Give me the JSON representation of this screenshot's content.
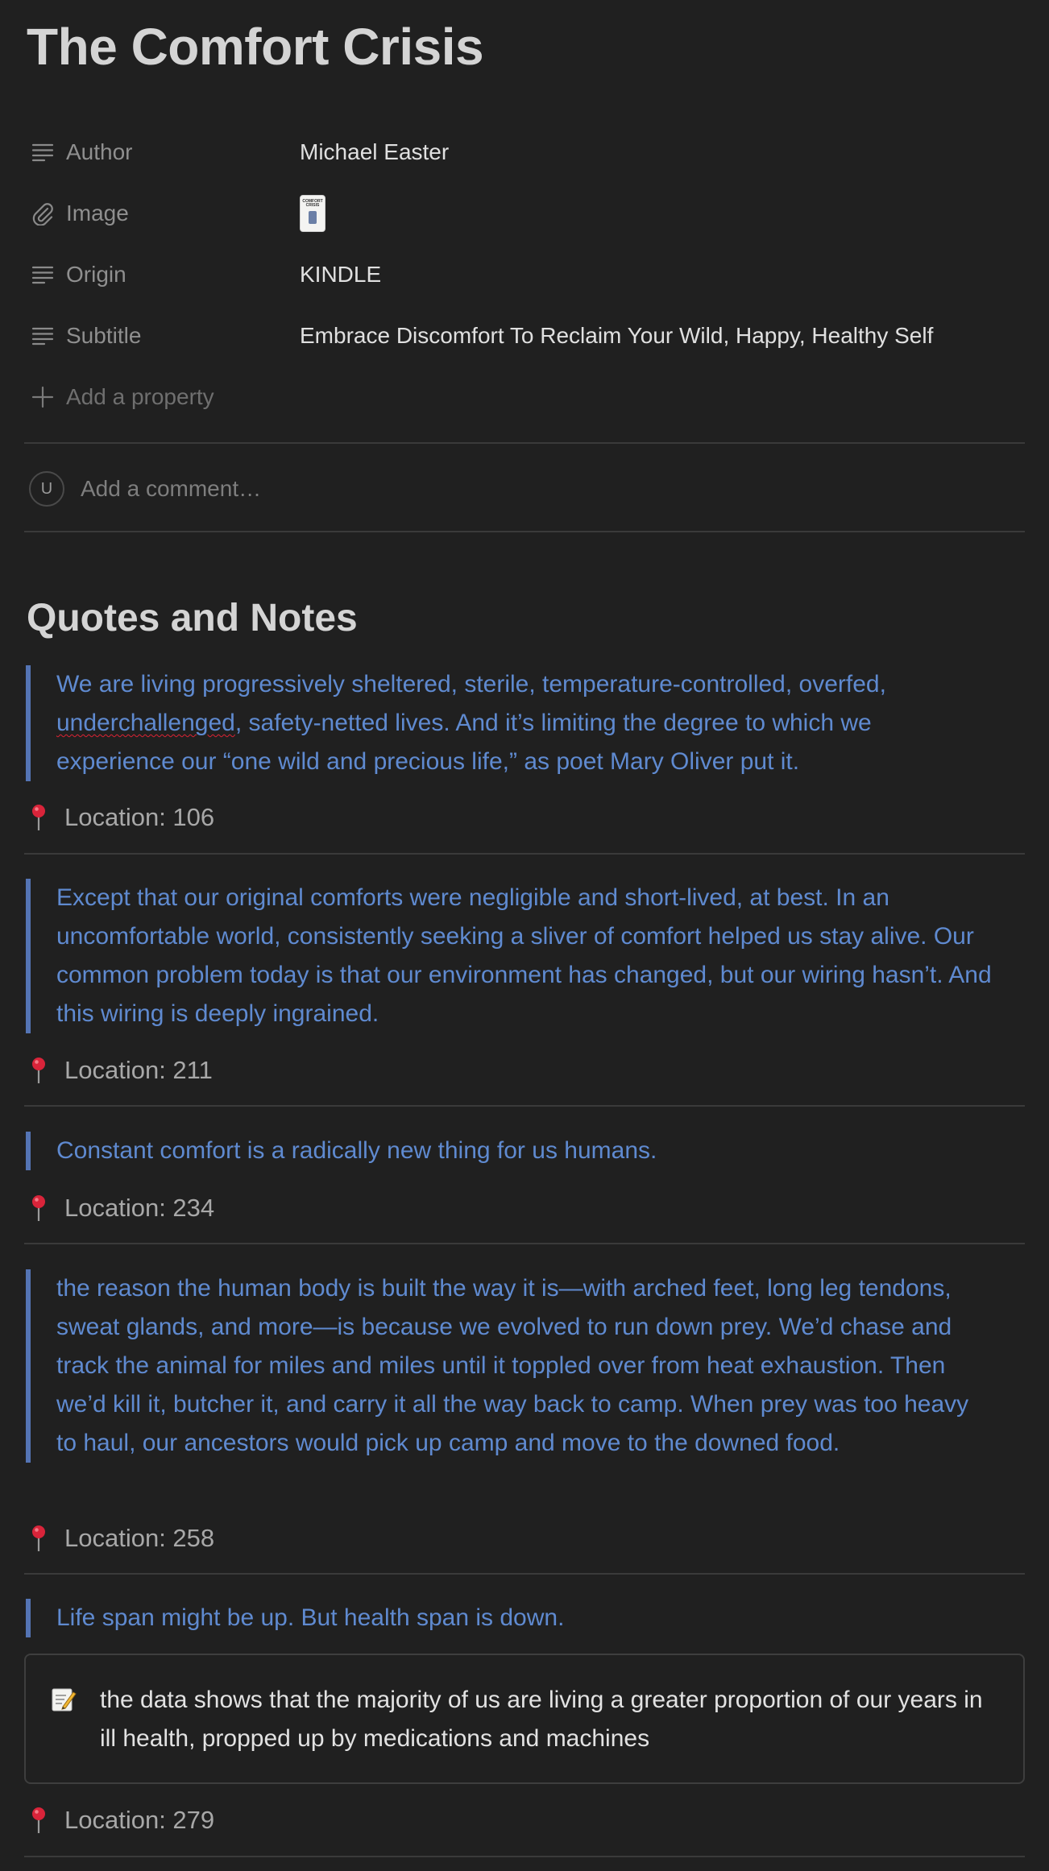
{
  "page": {
    "title": "The Comfort Crisis"
  },
  "properties": [
    {
      "label": "Author",
      "value": "Michael Easter",
      "icon": "text-lines-icon"
    },
    {
      "label": "Image",
      "value": "",
      "icon": "paperclip-icon"
    },
    {
      "label": "Origin",
      "value": "KINDLE",
      "icon": "text-lines-icon"
    },
    {
      "label": "Subtitle",
      "value": "Embrace Discomfort To Reclaim Your Wild, Happy, Healthy Self",
      "icon": "text-lines-icon"
    }
  ],
  "add_property_label": "Add a property",
  "comment": {
    "avatar_initial": "U",
    "placeholder": "Add a comment…"
  },
  "book_cover": {
    "title_line1": "COMFORT",
    "title_line2": "CRISIS"
  },
  "section": {
    "title": "Quotes and Notes"
  },
  "highlights": [
    {
      "quote_pre": "We are living progressively sheltered, sterile, temperature-controlled, overfed, ",
      "quote_misspelled": "underchallenged",
      "quote_post": ", safety-netted lives. And it’s limiting the degree to which we experience our “one wild and precious life,” as poet Mary Oliver put it.",
      "location": "Location: 106"
    },
    {
      "quote": "Except that our original comforts were negligible and short-lived, at best. In an uncomfortable world, consistently seeking a sliver of comfort helped us stay alive. Our common problem today is that our environment has changed, but our wiring hasn’t. And this wiring is deeply ingrained.",
      "location": "Location: 211"
    },
    {
      "quote": "Constant comfort is a radically new thing for us humans.",
      "location": "Location: 234"
    },
    {
      "quote": "the reason the human body is built the way it is—with arched feet, long leg tendons, sweat glands, and more—is because we evolved to run down prey. We’d chase and track the animal for miles and miles until it toppled over from heat exhaustion. Then we’d kill it, butcher it, and carry it all the way back to camp. When prey was too heavy to haul, our ancestors would pick up camp and move to the downed food.",
      "location": "Location: 258"
    },
    {
      "quote": "Life span might be up. But health span is down.",
      "note": "the data shows that the majority of us are living a greater proportion of our years in ill health, propped up by medications and machines",
      "location": "Location: 279"
    }
  ],
  "colors": {
    "background": "#202020",
    "quote_text": "#5f8ad0",
    "quote_bar": "#5474b4",
    "pin": "#d9243a"
  }
}
